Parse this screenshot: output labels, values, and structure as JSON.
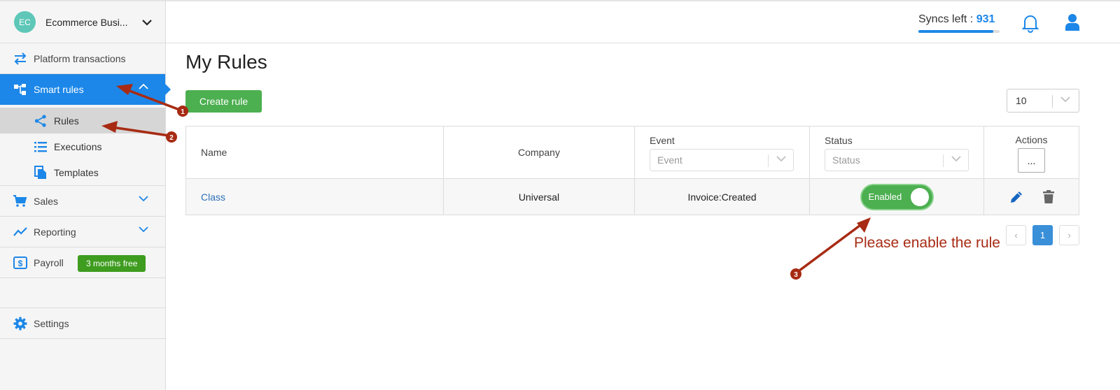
{
  "sidebar": {
    "company": {
      "initials": "EC",
      "name": "Ecommerce Busi..."
    },
    "items": [
      {
        "label": "Platform transactions",
        "icon": "swap-arrows-icon"
      },
      {
        "label": "Smart rules",
        "icon": "flowchart-icon"
      },
      {
        "label": "Sales",
        "icon": "cart-icon"
      },
      {
        "label": "Reporting",
        "icon": "trend-line-icon"
      },
      {
        "label": "Payroll",
        "icon": "dollar-icon",
        "badge": "3 months free"
      },
      {
        "label": "Settings",
        "icon": "gear-icon"
      }
    ],
    "subitems": [
      {
        "label": "Rules",
        "icon": "share-icon"
      },
      {
        "label": "Executions",
        "icon": "list-icon"
      },
      {
        "label": "Templates",
        "icon": "copy-icon"
      }
    ]
  },
  "header": {
    "syncs_label": "Syncs left : ",
    "syncs_value": "931",
    "syncs_fraction": 0.92
  },
  "main": {
    "title": "My Rules",
    "create_button": "Create rule",
    "page_size": "10",
    "table": {
      "columns": {
        "name": "Name",
        "company": "Company",
        "event": "Event",
        "event_filter_placeholder": "Event",
        "status": "Status",
        "status_filter_placeholder": "Status",
        "actions": "Actions",
        "actions_menu": "..."
      },
      "rows": [
        {
          "name": "Class",
          "company": "Universal",
          "event": "Invoice:Created",
          "status": "Enabled"
        }
      ]
    },
    "pagination": {
      "prev": "‹",
      "current": "1",
      "next": "›"
    }
  },
  "annotations": {
    "markers": [
      "1",
      "2",
      "3"
    ],
    "note": "Please enable the rule",
    "color": "#a72b13"
  },
  "colors": {
    "primary": "#1c87e8",
    "success": "#4caf50",
    "badge": "#3e9c1f"
  }
}
